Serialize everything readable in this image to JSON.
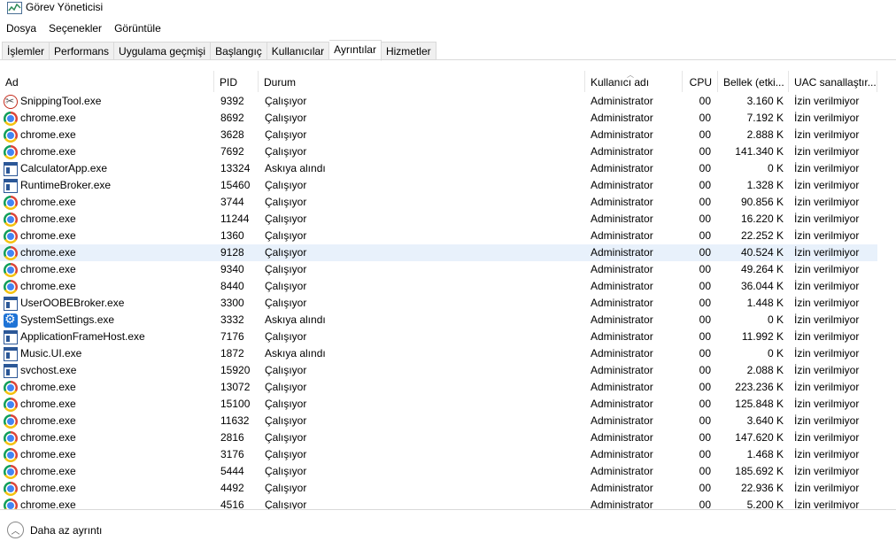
{
  "window": {
    "title": "Görev Yöneticisi",
    "app_icon": "task-manager-icon"
  },
  "menu": [
    {
      "name": "menu-dosya",
      "label": "Dosya"
    },
    {
      "name": "menu-secenekler",
      "label": "Seçenekler"
    },
    {
      "name": "menu-goruntule",
      "label": "Görüntüle"
    }
  ],
  "tabs": [
    {
      "name": "tab-islemler",
      "label": "İşlemler",
      "active": false
    },
    {
      "name": "tab-performans",
      "label": "Performans",
      "active": false
    },
    {
      "name": "tab-uygulama-gecmisi",
      "label": "Uygulama geçmişi",
      "active": false
    },
    {
      "name": "tab-baslangic",
      "label": "Başlangıç",
      "active": false
    },
    {
      "name": "tab-kullanicilar",
      "label": "Kullanıcılar",
      "active": false
    },
    {
      "name": "tab-ayrintilar",
      "label": "Ayrıntılar",
      "active": true
    },
    {
      "name": "tab-hizmetler",
      "label": "Hizmetler",
      "active": false
    }
  ],
  "columns": {
    "name": "Ad",
    "pid": "PID",
    "status": "Durum",
    "user": "Kullanıcı adı",
    "cpu": "CPU",
    "memory": "Bellek (etki...",
    "uac": "UAC sanallaştır..."
  },
  "sort_column": "user",
  "rows": [
    {
      "icon": "snipping-tool-icon",
      "name": "SnippingTool.exe",
      "pid": "9392",
      "status": "Çalışıyor",
      "user": "Administrator",
      "cpu": "00",
      "mem": "3.160 K",
      "uac": "İzin verilmiyor"
    },
    {
      "icon": "chrome-icon",
      "name": "chrome.exe",
      "pid": "8692",
      "status": "Çalışıyor",
      "user": "Administrator",
      "cpu": "00",
      "mem": "7.192 K",
      "uac": "İzin verilmiyor"
    },
    {
      "icon": "chrome-icon",
      "name": "chrome.exe",
      "pid": "3628",
      "status": "Çalışıyor",
      "user": "Administrator",
      "cpu": "00",
      "mem": "2.888 K",
      "uac": "İzin verilmiyor"
    },
    {
      "icon": "chrome-icon",
      "name": "chrome.exe",
      "pid": "7692",
      "status": "Çalışıyor",
      "user": "Administrator",
      "cpu": "00",
      "mem": "141.340 K",
      "uac": "İzin verilmiyor"
    },
    {
      "icon": "app-window-icon",
      "name": "CalculatorApp.exe",
      "pid": "13324",
      "status": "Askıya alındı",
      "user": "Administrator",
      "cpu": "00",
      "mem": "0 K",
      "uac": "İzin verilmiyor"
    },
    {
      "icon": "app-window-icon",
      "name": "RuntimeBroker.exe",
      "pid": "15460",
      "status": "Çalışıyor",
      "user": "Administrator",
      "cpu": "00",
      "mem": "1.328 K",
      "uac": "İzin verilmiyor"
    },
    {
      "icon": "chrome-icon",
      "name": "chrome.exe",
      "pid": "3744",
      "status": "Çalışıyor",
      "user": "Administrator",
      "cpu": "00",
      "mem": "90.856 K",
      "uac": "İzin verilmiyor"
    },
    {
      "icon": "chrome-icon",
      "name": "chrome.exe",
      "pid": "11244",
      "status": "Çalışıyor",
      "user": "Administrator",
      "cpu": "00",
      "mem": "16.220 K",
      "uac": "İzin verilmiyor"
    },
    {
      "icon": "chrome-icon",
      "name": "chrome.exe",
      "pid": "1360",
      "status": "Çalışıyor",
      "user": "Administrator",
      "cpu": "00",
      "mem": "22.252 K",
      "uac": "İzin verilmiyor"
    },
    {
      "icon": "chrome-icon",
      "name": "chrome.exe",
      "pid": "9128",
      "status": "Çalışıyor",
      "user": "Administrator",
      "cpu": "00",
      "mem": "40.524 K",
      "uac": "İzin verilmiyor",
      "selected": true
    },
    {
      "icon": "chrome-icon",
      "name": "chrome.exe",
      "pid": "9340",
      "status": "Çalışıyor",
      "user": "Administrator",
      "cpu": "00",
      "mem": "49.264 K",
      "uac": "İzin verilmiyor"
    },
    {
      "icon": "chrome-icon",
      "name": "chrome.exe",
      "pid": "8440",
      "status": "Çalışıyor",
      "user": "Administrator",
      "cpu": "00",
      "mem": "36.044 K",
      "uac": "İzin verilmiyor"
    },
    {
      "icon": "app-window-icon",
      "name": "UserOOBEBroker.exe",
      "pid": "3300",
      "status": "Çalışıyor",
      "user": "Administrator",
      "cpu": "00",
      "mem": "1.448 K",
      "uac": "İzin verilmiyor"
    },
    {
      "icon": "settings-gear-icon",
      "name": "SystemSettings.exe",
      "pid": "3332",
      "status": "Askıya alındı",
      "user": "Administrator",
      "cpu": "00",
      "mem": "0 K",
      "uac": "İzin verilmiyor"
    },
    {
      "icon": "app-window-icon",
      "name": "ApplicationFrameHost.exe",
      "pid": "7176",
      "status": "Çalışıyor",
      "user": "Administrator",
      "cpu": "00",
      "mem": "11.992 K",
      "uac": "İzin verilmiyor"
    },
    {
      "icon": "app-window-icon",
      "name": "Music.UI.exe",
      "pid": "1872",
      "status": "Askıya alındı",
      "user": "Administrator",
      "cpu": "00",
      "mem": "0 K",
      "uac": "İzin verilmiyor"
    },
    {
      "icon": "app-window-icon",
      "name": "svchost.exe",
      "pid": "15920",
      "status": "Çalışıyor",
      "user": "Administrator",
      "cpu": "00",
      "mem": "2.088 K",
      "uac": "İzin verilmiyor"
    },
    {
      "icon": "chrome-icon",
      "name": "chrome.exe",
      "pid": "13072",
      "status": "Çalışıyor",
      "user": "Administrator",
      "cpu": "00",
      "mem": "223.236 K",
      "uac": "İzin verilmiyor"
    },
    {
      "icon": "chrome-icon",
      "name": "chrome.exe",
      "pid": "15100",
      "status": "Çalışıyor",
      "user": "Administrator",
      "cpu": "00",
      "mem": "125.848 K",
      "uac": "İzin verilmiyor"
    },
    {
      "icon": "chrome-icon",
      "name": "chrome.exe",
      "pid": "11632",
      "status": "Çalışıyor",
      "user": "Administrator",
      "cpu": "00",
      "mem": "3.640 K",
      "uac": "İzin verilmiyor"
    },
    {
      "icon": "chrome-icon",
      "name": "chrome.exe",
      "pid": "2816",
      "status": "Çalışıyor",
      "user": "Administrator",
      "cpu": "00",
      "mem": "147.620 K",
      "uac": "İzin verilmiyor"
    },
    {
      "icon": "chrome-icon",
      "name": "chrome.exe",
      "pid": "3176",
      "status": "Çalışıyor",
      "user": "Administrator",
      "cpu": "00",
      "mem": "1.468 K",
      "uac": "İzin verilmiyor"
    },
    {
      "icon": "chrome-icon",
      "name": "chrome.exe",
      "pid": "5444",
      "status": "Çalışıyor",
      "user": "Administrator",
      "cpu": "00",
      "mem": "185.692 K",
      "uac": "İzin verilmiyor"
    },
    {
      "icon": "chrome-icon",
      "name": "chrome.exe",
      "pid": "4492",
      "status": "Çalışıyor",
      "user": "Administrator",
      "cpu": "00",
      "mem": "22.936 K",
      "uac": "İzin verilmiyor"
    },
    {
      "icon": "chrome-icon",
      "name": "chrome.exe",
      "pid": "4516",
      "status": "Çalışıyor",
      "user": "Administrator",
      "cpu": "00",
      "mem": "5.200 K",
      "uac": "İzin verilmiyor"
    }
  ],
  "footer": {
    "label": "Daha az ayrıntı",
    "icon": "chevron-up-circle-icon"
  },
  "colors": {
    "selected_row": "#e8f1fb",
    "border": "#d9d9d9"
  }
}
